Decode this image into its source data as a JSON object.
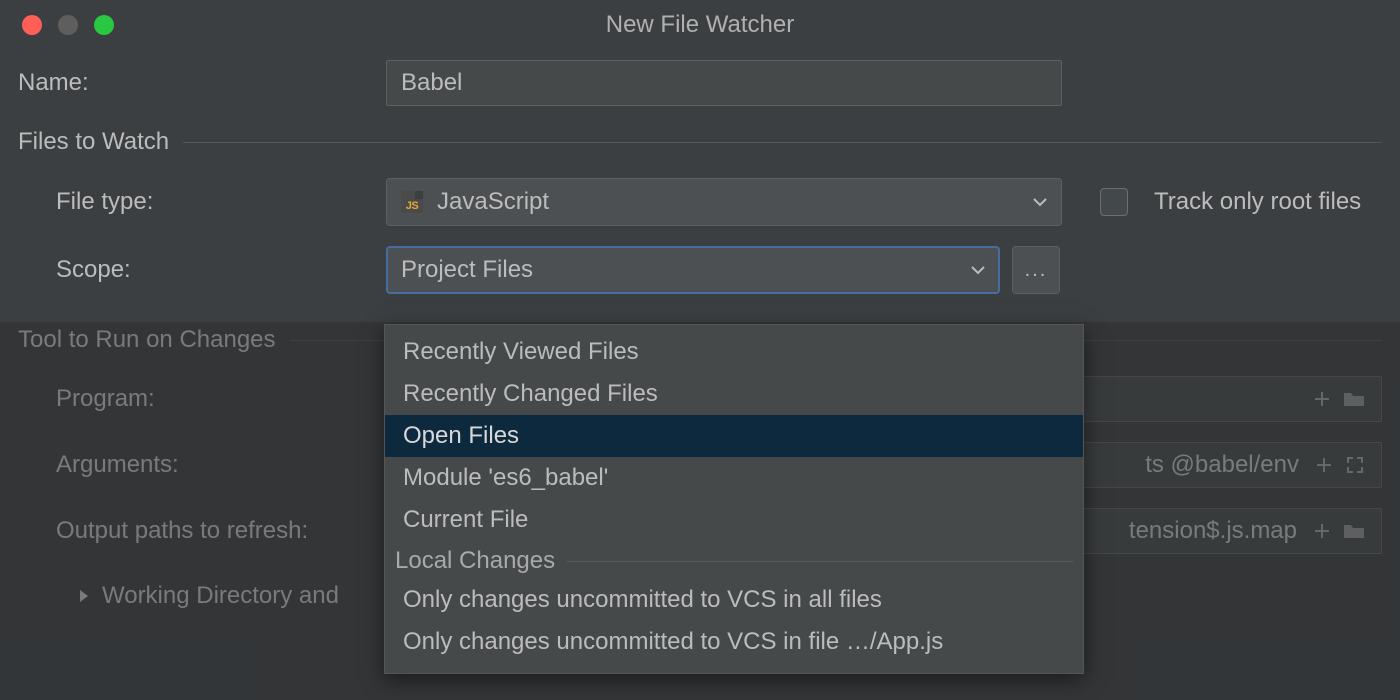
{
  "window": {
    "title": "New File Watcher"
  },
  "fields": {
    "name_label": "Name:",
    "name_value": "Babel",
    "section_files": "Files to Watch",
    "filetype_label": "File type:",
    "filetype_value": "JavaScript",
    "track_root_label": "Track only root files",
    "scope_label": "Scope:",
    "scope_value": "Project Files",
    "ellipsis": "...",
    "section_tool": "Tool to Run on Changes",
    "program_label": "Program:",
    "program_value": "",
    "arguments_label": "Arguments:",
    "arguments_value": "ts @babel/env",
    "outputpaths_label": "Output paths to refresh:",
    "outputpaths_value": "tension$.js.map",
    "working_dir_label": "Working Directory and"
  },
  "scope_popup": {
    "items_top": [
      "Recently Viewed Files",
      "Recently Changed Files",
      "Open Files",
      "Module 'es6_babel'",
      "Current File"
    ],
    "selected_index": 2,
    "group_label": "Local Changes",
    "items_group": [
      "Only changes uncommitted to VCS in all files",
      "Only changes uncommitted to VCS in file …/App.js"
    ]
  }
}
